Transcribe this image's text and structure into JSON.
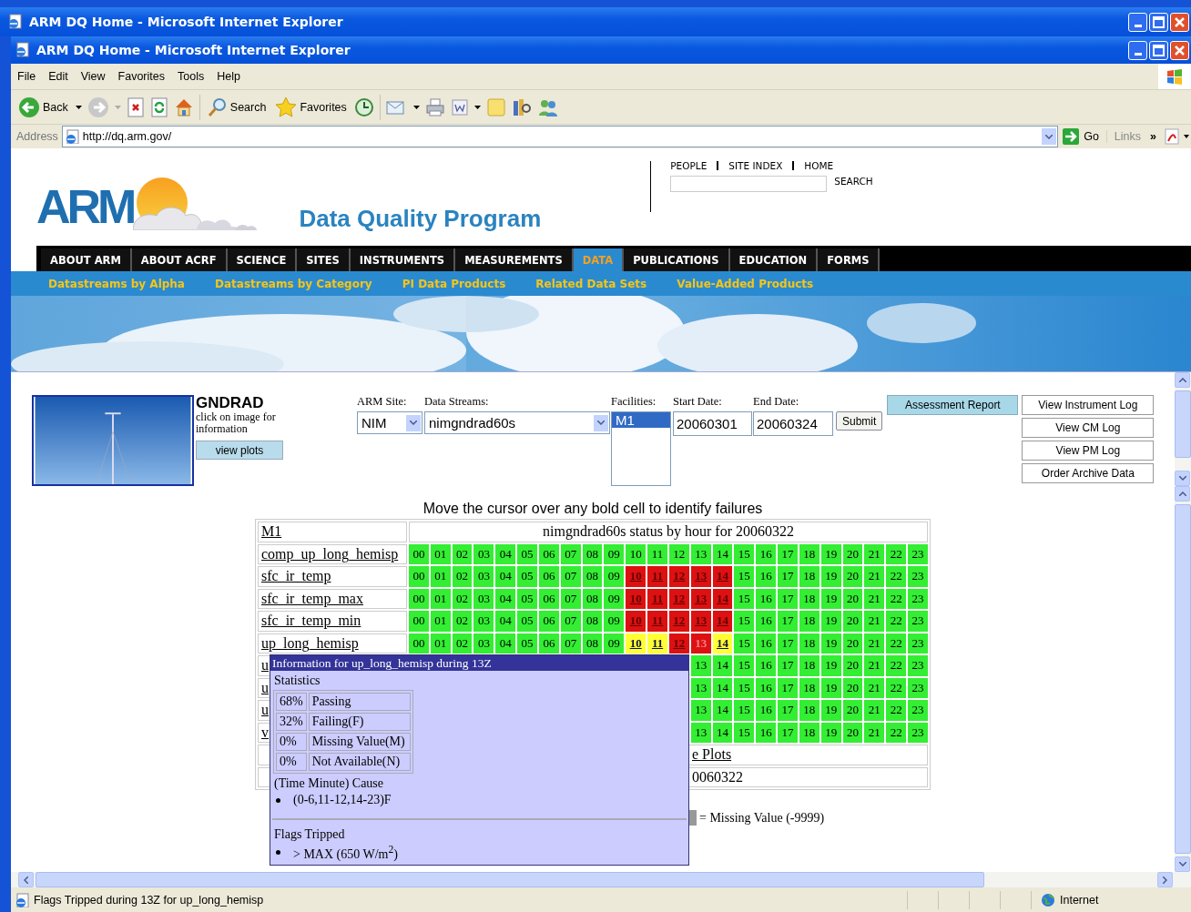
{
  "browser": {
    "outer_title": "ARM DQ Home - Microsoft Internet Explorer",
    "title": "ARM DQ Home - Microsoft Internet Explorer",
    "menu": [
      "File",
      "Edit",
      "View",
      "Favorites",
      "Tools",
      "Help"
    ],
    "toolbar": {
      "back": "Back",
      "search": "Search",
      "favorites": "Favorites"
    },
    "address": {
      "label": "Address",
      "url": "http://dq.arm.gov/",
      "go": "Go",
      "links": "Links",
      "more": "»"
    }
  },
  "header": {
    "logo": "ARM",
    "title": "Data Quality Program",
    "top_links": [
      "PEOPLE",
      "SITE INDEX",
      "HOME"
    ],
    "search_button": "SEARCH"
  },
  "nav_tabs": [
    {
      "label": "ABOUT ARM",
      "selected": false
    },
    {
      "label": "ABOUT ACRF",
      "selected": false
    },
    {
      "label": "SCIENCE",
      "selected": false
    },
    {
      "label": "SITES",
      "selected": false
    },
    {
      "label": "INSTRUMENTS",
      "selected": false
    },
    {
      "label": "MEASUREMENTS",
      "selected": false
    },
    {
      "label": "DATA",
      "selected": true
    },
    {
      "label": "PUBLICATIONS",
      "selected": false
    },
    {
      "label": "EDUCATION",
      "selected": false
    },
    {
      "label": "FORMS",
      "selected": false
    }
  ],
  "sub_nav": [
    "Datastreams by Alpha",
    "Datastreams by Category",
    "PI Data Products",
    "Related Data Sets",
    "Value-Added Products"
  ],
  "instrument": {
    "name": "GNDRAD",
    "hint": "click on image for information",
    "plots_button": "view plots"
  },
  "query_form": {
    "site": {
      "label": "ARM Site:",
      "value": "NIM"
    },
    "datastream": {
      "label": "Data Streams:",
      "value": "nimgndrad60s"
    },
    "facilities": {
      "label": "Facilities:",
      "options": [
        {
          "label": "M1",
          "selected": true
        }
      ]
    },
    "start_date": {
      "label": "Start Date:",
      "value": "20060301"
    },
    "end_date": {
      "label": "End Date:",
      "value": "20060324"
    },
    "submit": "Submit",
    "report_button": "Assessment Report",
    "log_buttons": [
      "View Instrument Log",
      "View CM Log",
      "View PM Log",
      "Order Archive Data"
    ]
  },
  "status_table": {
    "heading": "Move the cursor over any bold cell to identify failures",
    "facility": "M1",
    "title": "nimgndrad60s status by hour for 20060322",
    "rows": [
      {
        "name": "comp_up_long_hemisp",
        "hours": [
          {
            "label": "00",
            "kind": "pass"
          },
          {
            "label": "01",
            "kind": "pass"
          },
          {
            "label": "02",
            "kind": "pass"
          },
          {
            "label": "03",
            "kind": "pass"
          },
          {
            "label": "04",
            "kind": "pass"
          },
          {
            "label": "05",
            "kind": "pass"
          },
          {
            "label": "06",
            "kind": "pass"
          },
          {
            "label": "07",
            "kind": "pass"
          },
          {
            "label": "08",
            "kind": "pass"
          },
          {
            "label": "09",
            "kind": "pass"
          },
          {
            "label": "10",
            "kind": "pass"
          },
          {
            "label": "11",
            "kind": "pass"
          },
          {
            "label": "12",
            "kind": "pass"
          },
          {
            "label": "13",
            "kind": "pass"
          },
          {
            "label": "14",
            "kind": "pass"
          },
          {
            "label": "15",
            "kind": "pass"
          },
          {
            "label": "16",
            "kind": "pass"
          },
          {
            "label": "17",
            "kind": "pass"
          },
          {
            "label": "18",
            "kind": "pass"
          },
          {
            "label": "19",
            "kind": "pass"
          },
          {
            "label": "20",
            "kind": "pass"
          },
          {
            "label": "21",
            "kind": "pass"
          },
          {
            "label": "22",
            "kind": "pass"
          },
          {
            "label": "23",
            "kind": "pass"
          }
        ]
      },
      {
        "name": "sfc_ir_temp",
        "hours": [
          {
            "label": "00",
            "kind": "pass"
          },
          {
            "label": "01",
            "kind": "pass"
          },
          {
            "label": "02",
            "kind": "pass"
          },
          {
            "label": "03",
            "kind": "pass"
          },
          {
            "label": "04",
            "kind": "pass"
          },
          {
            "label": "05",
            "kind": "pass"
          },
          {
            "label": "06",
            "kind": "pass"
          },
          {
            "label": "07",
            "kind": "pass"
          },
          {
            "label": "08",
            "kind": "pass"
          },
          {
            "label": "09",
            "kind": "pass"
          },
          {
            "label": "10",
            "kind": "fail"
          },
          {
            "label": "11",
            "kind": "fail"
          },
          {
            "label": "12",
            "kind": "fail"
          },
          {
            "label": "13",
            "kind": "fail"
          },
          {
            "label": "14",
            "kind": "fail"
          },
          {
            "label": "15",
            "kind": "pass"
          },
          {
            "label": "16",
            "kind": "pass"
          },
          {
            "label": "17",
            "kind": "pass"
          },
          {
            "label": "18",
            "kind": "pass"
          },
          {
            "label": "19",
            "kind": "pass"
          },
          {
            "label": "20",
            "kind": "pass"
          },
          {
            "label": "21",
            "kind": "pass"
          },
          {
            "label": "22",
            "kind": "pass"
          },
          {
            "label": "23",
            "kind": "pass"
          }
        ]
      },
      {
        "name": "sfc_ir_temp_max",
        "hours": [
          {
            "label": "00",
            "kind": "pass"
          },
          {
            "label": "01",
            "kind": "pass"
          },
          {
            "label": "02",
            "kind": "pass"
          },
          {
            "label": "03",
            "kind": "pass"
          },
          {
            "label": "04",
            "kind": "pass"
          },
          {
            "label": "05",
            "kind": "pass"
          },
          {
            "label": "06",
            "kind": "pass"
          },
          {
            "label": "07",
            "kind": "pass"
          },
          {
            "label": "08",
            "kind": "pass"
          },
          {
            "label": "09",
            "kind": "pass"
          },
          {
            "label": "10",
            "kind": "fail"
          },
          {
            "label": "11",
            "kind": "fail"
          },
          {
            "label": "12",
            "kind": "fail"
          },
          {
            "label": "13",
            "kind": "fail"
          },
          {
            "label": "14",
            "kind": "fail"
          },
          {
            "label": "15",
            "kind": "pass"
          },
          {
            "label": "16",
            "kind": "pass"
          },
          {
            "label": "17",
            "kind": "pass"
          },
          {
            "label": "18",
            "kind": "pass"
          },
          {
            "label": "19",
            "kind": "pass"
          },
          {
            "label": "20",
            "kind": "pass"
          },
          {
            "label": "21",
            "kind": "pass"
          },
          {
            "label": "22",
            "kind": "pass"
          },
          {
            "label": "23",
            "kind": "pass"
          }
        ]
      },
      {
        "name": "sfc_ir_temp_min",
        "hours": [
          {
            "label": "00",
            "kind": "pass"
          },
          {
            "label": "01",
            "kind": "pass"
          },
          {
            "label": "02",
            "kind": "pass"
          },
          {
            "label": "03",
            "kind": "pass"
          },
          {
            "label": "04",
            "kind": "pass"
          },
          {
            "label": "05",
            "kind": "pass"
          },
          {
            "label": "06",
            "kind": "pass"
          },
          {
            "label": "07",
            "kind": "pass"
          },
          {
            "label": "08",
            "kind": "pass"
          },
          {
            "label": "09",
            "kind": "pass"
          },
          {
            "label": "10",
            "kind": "fail"
          },
          {
            "label": "11",
            "kind": "fail"
          },
          {
            "label": "12",
            "kind": "fail"
          },
          {
            "label": "13",
            "kind": "fail"
          },
          {
            "label": "14",
            "kind": "fail"
          },
          {
            "label": "15",
            "kind": "pass"
          },
          {
            "label": "16",
            "kind": "pass"
          },
          {
            "label": "17",
            "kind": "pass"
          },
          {
            "label": "18",
            "kind": "pass"
          },
          {
            "label": "19",
            "kind": "pass"
          },
          {
            "label": "20",
            "kind": "pass"
          },
          {
            "label": "21",
            "kind": "pass"
          },
          {
            "label": "22",
            "kind": "pass"
          },
          {
            "label": "23",
            "kind": "pass"
          }
        ]
      },
      {
        "name": "up_long_hemisp",
        "hours": [
          {
            "label": "00",
            "kind": "pass"
          },
          {
            "label": "01",
            "kind": "pass"
          },
          {
            "label": "02",
            "kind": "pass"
          },
          {
            "label": "03",
            "kind": "pass"
          },
          {
            "label": "04",
            "kind": "pass"
          },
          {
            "label": "05",
            "kind": "pass"
          },
          {
            "label": "06",
            "kind": "pass"
          },
          {
            "label": "07",
            "kind": "pass"
          },
          {
            "label": "08",
            "kind": "pass"
          },
          {
            "label": "09",
            "kind": "pass"
          },
          {
            "label": "10",
            "kind": "warn"
          },
          {
            "label": "11",
            "kind": "warn"
          },
          {
            "label": "12",
            "kind": "fail"
          },
          {
            "label": "13",
            "kind": "active"
          },
          {
            "label": "14",
            "kind": "warn"
          },
          {
            "label": "15",
            "kind": "pass"
          },
          {
            "label": "16",
            "kind": "pass"
          },
          {
            "label": "17",
            "kind": "pass"
          },
          {
            "label": "18",
            "kind": "pass"
          },
          {
            "label": "19",
            "kind": "pass"
          },
          {
            "label": "20",
            "kind": "pass"
          },
          {
            "label": "21",
            "kind": "pass"
          },
          {
            "label": "22",
            "kind": "pass"
          },
          {
            "label": "23",
            "kind": "pass"
          }
        ]
      },
      {
        "name": "u",
        "hours": [
          {
            "label": "13",
            "kind": "pass"
          },
          {
            "label": "14",
            "kind": "pass"
          },
          {
            "label": "15",
            "kind": "pass"
          },
          {
            "label": "16",
            "kind": "pass"
          },
          {
            "label": "17",
            "kind": "pass"
          },
          {
            "label": "18",
            "kind": "pass"
          },
          {
            "label": "19",
            "kind": "pass"
          },
          {
            "label": "20",
            "kind": "pass"
          },
          {
            "label": "21",
            "kind": "pass"
          },
          {
            "label": "22",
            "kind": "pass"
          },
          {
            "label": "23",
            "kind": "pass"
          }
        ]
      },
      {
        "name": "u",
        "hours": [
          {
            "label": "13",
            "kind": "pass"
          },
          {
            "label": "14",
            "kind": "pass"
          },
          {
            "label": "15",
            "kind": "pass"
          },
          {
            "label": "16",
            "kind": "pass"
          },
          {
            "label": "17",
            "kind": "pass"
          },
          {
            "label": "18",
            "kind": "pass"
          },
          {
            "label": "19",
            "kind": "pass"
          },
          {
            "label": "20",
            "kind": "pass"
          },
          {
            "label": "21",
            "kind": "pass"
          },
          {
            "label": "22",
            "kind": "pass"
          },
          {
            "label": "23",
            "kind": "pass"
          }
        ]
      },
      {
        "name": "u",
        "hours": [
          {
            "label": "13",
            "kind": "pass"
          },
          {
            "label": "14",
            "kind": "pass"
          },
          {
            "label": "15",
            "kind": "pass"
          },
          {
            "label": "16",
            "kind": "pass"
          },
          {
            "label": "17",
            "kind": "pass"
          },
          {
            "label": "18",
            "kind": "pass"
          },
          {
            "label": "19",
            "kind": "pass"
          },
          {
            "label": "20",
            "kind": "pass"
          },
          {
            "label": "21",
            "kind": "pass"
          },
          {
            "label": "22",
            "kind": "pass"
          },
          {
            "label": "23",
            "kind": "pass"
          }
        ]
      },
      {
        "name": "v",
        "hours": [
          {
            "label": "13",
            "kind": "pass"
          },
          {
            "label": "14",
            "kind": "pass"
          },
          {
            "label": "15",
            "kind": "pass"
          },
          {
            "label": "16",
            "kind": "pass"
          },
          {
            "label": "17",
            "kind": "pass"
          },
          {
            "label": "18",
            "kind": "pass"
          },
          {
            "label": "19",
            "kind": "pass"
          },
          {
            "label": "20",
            "kind": "pass"
          },
          {
            "label": "21",
            "kind": "pass"
          },
          {
            "label": "22",
            "kind": "pass"
          },
          {
            "label": "23",
            "kind": "pass"
          }
        ]
      }
    ],
    "plots_link": "e Plots",
    "date": "0060322",
    "legend": "= Missing Value (-9999)"
  },
  "tooltip": {
    "title": "Information for up_long_hemisp during 13Z",
    "stats_heading": "Statistics",
    "stats": [
      {
        "percent": "68%",
        "label": "Passing"
      },
      {
        "percent": "32%",
        "label": "Failing(F)"
      },
      {
        "percent": "0%",
        "label": "Missing Value(M)"
      },
      {
        "percent": "0%",
        "label": "Not Available(N)"
      }
    ],
    "cause_heading": "(Time Minute) Cause",
    "causes": [
      "(0-6,11-12,14-23)F"
    ],
    "flags_heading": "Flags Tripped",
    "flags": [
      "> MAX (650 W/m$^{2}$)"
    ]
  },
  "status_bar": {
    "text": "Flags Tripped during 13Z for up_long_hemisp",
    "zone": "Internet"
  }
}
